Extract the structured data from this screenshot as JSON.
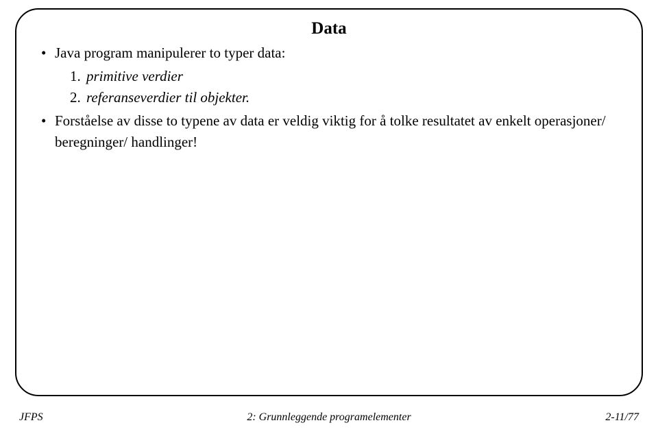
{
  "title": "Data",
  "bullets": {
    "b1": "Java program manipulerer to typer data:",
    "b2": "Forståelse av disse to typene av data er veldig viktig for å tolke resultatet av enkelt operasjoner/ beregninger/ handlinger!"
  },
  "sub": {
    "s1": "primitive verdier",
    "s2": "referanseverdier til objekter."
  },
  "footer": {
    "left": "JFPS",
    "center": "2: Grunnleggende programelementer",
    "right": "2-11/77"
  }
}
